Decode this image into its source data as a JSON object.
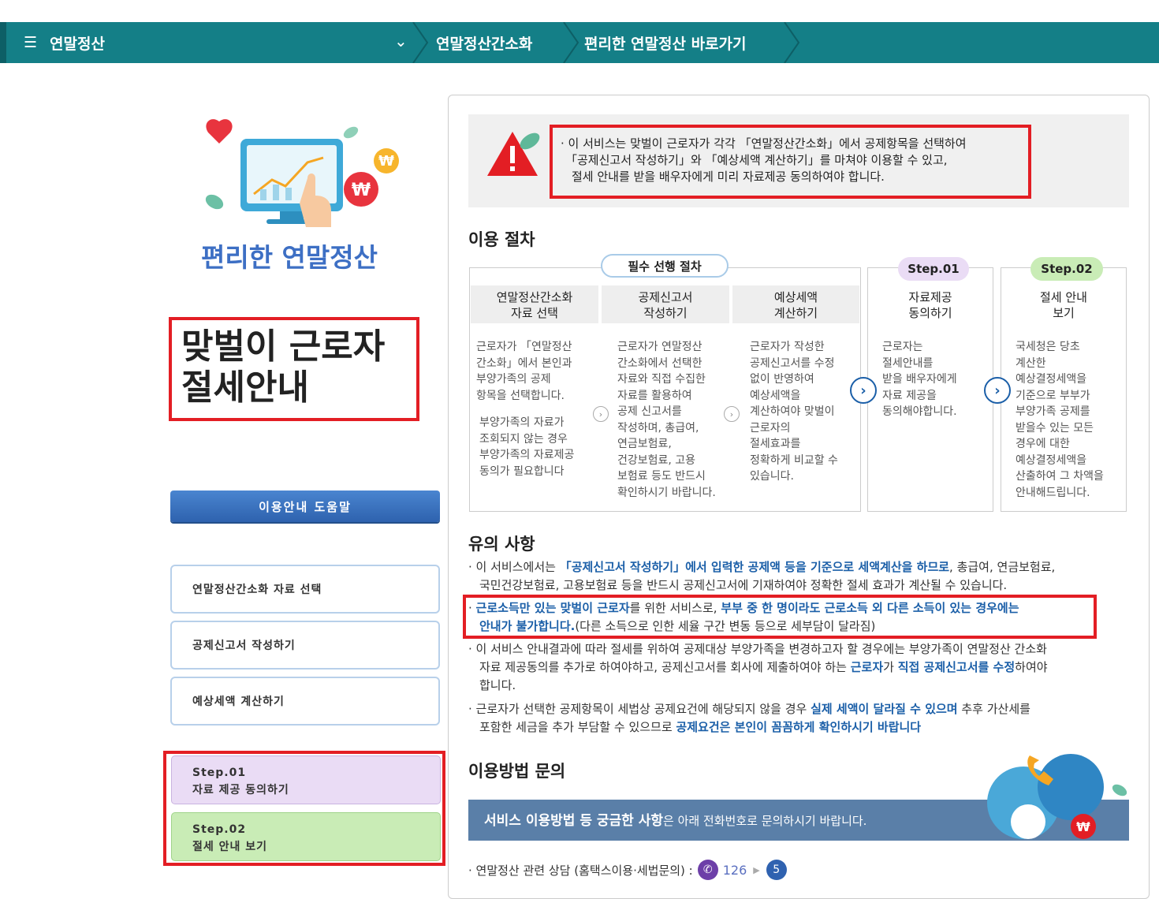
{
  "topbar": {
    "menu_title": "연말정산",
    "crumbs": [
      "연말정산간소화",
      "편리한 연말정산 바로가기"
    ]
  },
  "sidebar": {
    "brand_title": "편리한 연말정산",
    "main_title": "맞벌이 근로자\n절세안내",
    "help_button": "이용안내 도움말",
    "nav": [
      "연말정산간소화 자료 선택",
      "공제신고서 작성하기",
      "예상세액 계산하기"
    ],
    "steps": [
      {
        "step": "Step.01",
        "label": "자료 제공 동의하기"
      },
      {
        "step": "Step.02",
        "label": "절세 안내 보기"
      }
    ]
  },
  "alert": {
    "lines": [
      "· 이 서비스는 맞벌이 근로자가 각각 「연말정산간소화」에서 공제항목을 선택하여",
      "「공제신고서 작성하기」와 「예상세액 계산하기」를 마쳐야 이용할 수 있고,",
      "절세 안내를 받을 배우자에게 미리 자료제공 동의하여야 합니다."
    ]
  },
  "procedure": {
    "heading": "이용 절차",
    "required_pill": "필수 선행 절차",
    "columns": [
      {
        "head": "연말정산간소화\n자료 선택",
        "body": "근로자가 「연말정산\n간소화」에서 본인과\n부양가족의 공제\n항목을 선택합니다.",
        "body2": "부양가족의 자료가\n조회되지 않는 경우\n부양가족의 자료제공\n동의가 필요합니다"
      },
      {
        "head": "공제신고서\n작성하기",
        "body": "근로자가 연말정산\n간소화에서 선택한\n자료와 직접 수집한\n자료를 활용하여\n공제 신고서를\n작성하며, 총급여,\n연금보험료,\n건강보험료, 고용\n보험료 등도 반드시\n확인하시기 바랍니다."
      },
      {
        "head": "예상세액\n계산하기",
        "body": "근로자가 작성한\n공제신고서를 수정\n없이 반영하여\n예상세액을\n계산하여야 맞벌이\n근로자의\n절세효과를\n정확하게 비교할 수\n있습니다."
      },
      {
        "pill": "Step.01",
        "head": "자료제공\n동의하기",
        "body": "근로자는\n절세안내를\n받을 배우자에게\n자료 제공을\n동의해야합니다."
      },
      {
        "pill": "Step.02",
        "head": "절세 안내\n보기",
        "body": "국세청은 당초\n계산한\n예상결정세액을\n기준으로 부부가\n부양가족 공제를\n받을수 있는 모든\n경우에 대한\n예상결정세액을\n산출하여 그 차액을\n안내해드립니다."
      }
    ]
  },
  "notes": {
    "heading": "유의 사항",
    "n1_a": "이 서비스에서는 ",
    "n1_b": "「공제신고서 작성하기」에서 입력한 공제액 등을 기준으로 세액계산을 하므로",
    "n1_c": ", 총급여, 연금보험료,",
    "n1_d": "국민건강보험료, 고용보험료 등을 반드시 공제신고서에 기재하여야 정확한 절세 효과가 계산될 수 있습니다.",
    "n2_a": "근로소득만 있는 맞벌이 근로자",
    "n2_b": "를 위한 서비스로, ",
    "n2_c": "부부 중 한 명이라도 근로소득 외 다른 소득이  있는 경우에는",
    "n2_d": "안내가 불가합니다.",
    "n2_e": "(다른 소득으로 인한 세율 구간 변동 등으로 세부담이 달라짐)",
    "n3_a": "이 서비스 안내결과에 따라 절세를 위하여 공제대상 부양가족을 변경하고자 할 경우에는 부양가족이 연말정산 간소화",
    "n3_b": "자료 제공동의를 추가로 하여야하고, 공제신고서를 회사에 제출하여야 하는 ",
    "n3_c": "근로자",
    "n3_d": "가 ",
    "n3_e": "직접 공제신고서를 수정",
    "n3_f": "하여야",
    "n3_g": "합니다.",
    "n4_a": "근로자가 선택한 공제항목이 세법상 공제요건에 해당되지 않을 경우 ",
    "n4_b": "실제 세액이 달라질 수 있으며",
    "n4_c": " 추후 가산세를",
    "n4_d": "포함한 세금을 추가 부담할 수 있으므로 ",
    "n4_e": "공제요건은 본인이 꼼꼼하게 확인하시기 바랍니다"
  },
  "inquiry": {
    "heading": "이용방법 문의",
    "banner_bold": "서비스 이용방법 등 궁금한 사항",
    "banner_rest": "은 아래 전화번호로 문의하시기 바랍니다.",
    "contact_label": "· 연말정산 관련 상담 (홈택스이용·세법문의) : ",
    "phone": "126",
    "option": "5"
  },
  "colors": {
    "teal": "#147f87",
    "red": "#e31e24",
    "blue": "#1b5fa8",
    "step1": "#eadcf5",
    "step2": "#c9ecb6"
  }
}
